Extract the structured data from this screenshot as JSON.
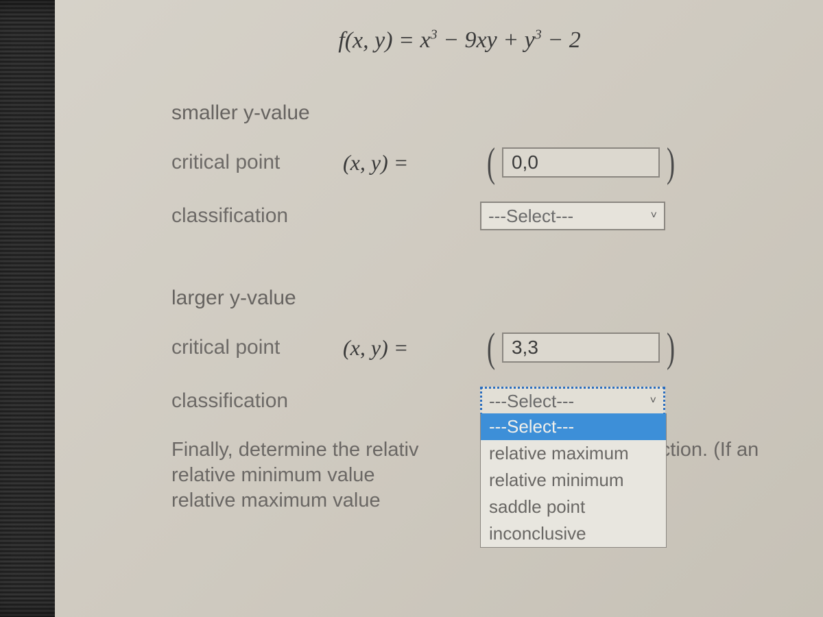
{
  "formula": {
    "lhs": "f(x, y)",
    "rhs_plain": "x³ − 9xy + y³ − 2"
  },
  "section1": {
    "heading": "smaller y-value",
    "critical_label": "critical point",
    "xy_label": "(x, y)  =",
    "critical_value": "0,0",
    "class_label": "classification",
    "class_selected": "---Select---"
  },
  "section2": {
    "heading": "larger y-value",
    "critical_label": "critical point",
    "xy_label": "(x, y)  =",
    "critical_value": "3,3",
    "class_label": "classification",
    "class_selected": "---Select---"
  },
  "dropdown_options": {
    "o0": "---Select---",
    "o1": "relative maximum",
    "o2": "relative minimum",
    "o3": "saddle point",
    "o4": "inconclusive"
  },
  "final": {
    "line1_left": "Finally, determine the relativ",
    "line1_right": "unction. (If an",
    "line2": "relative minimum value",
    "line3": "relative maximum value"
  }
}
